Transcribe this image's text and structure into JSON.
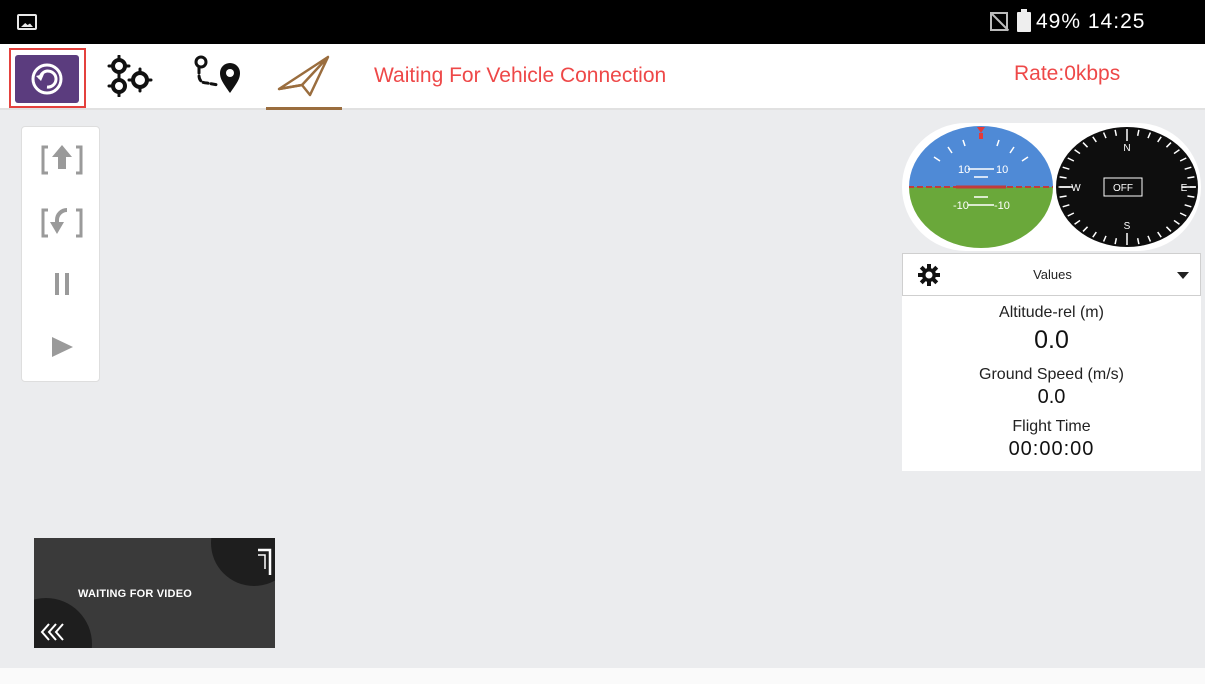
{
  "status_bar": {
    "battery": "49%",
    "time": "14:25",
    "icons": [
      "image-notification-icon",
      "no-sim-icon",
      "battery-icon"
    ]
  },
  "toolbar": {
    "back_icon": "back-arrow-icon",
    "tabs": [
      {
        "name": "settings",
        "icon": "gears-icon"
      },
      {
        "name": "route-planning",
        "icon": "route-pin-icon"
      },
      {
        "name": "flight",
        "icon": "paper-plane-icon",
        "selected": true
      }
    ],
    "status_message": "Waiting For Vehicle Connection",
    "rate": "Rate:0kbps"
  },
  "mission_controls": [
    {
      "name": "upload-mission",
      "icon": "upload-icon"
    },
    {
      "name": "download-mission",
      "icon": "download-back-icon"
    },
    {
      "name": "pause",
      "icon": "pause-icon"
    },
    {
      "name": "play",
      "icon": "play-icon"
    }
  ],
  "instruments": {
    "attitude": {
      "pitch_labels_top": [
        "10",
        "10"
      ],
      "pitch_labels_bottom": [
        "-10",
        "-10"
      ]
    },
    "compass": {
      "center": "OFF",
      "north": "N",
      "south": "S",
      "east": "E",
      "west": "W"
    }
  },
  "telemetry": {
    "selector": "Values",
    "items": [
      {
        "label": "Altitude-rel (m)",
        "value": "0.0"
      },
      {
        "label": "Ground Speed (m/s)",
        "value": "0.0"
      },
      {
        "label": "Flight Time",
        "value": "00:00:00"
      }
    ]
  },
  "video": {
    "label": "WAITING FOR VIDEO"
  },
  "colors": {
    "accent_red": "#ee4848",
    "back_button_bg": "#5b3c7e",
    "selected_tab": "#9a6d3e",
    "sky": "#4f8ad6",
    "ground": "#6aa83a"
  }
}
